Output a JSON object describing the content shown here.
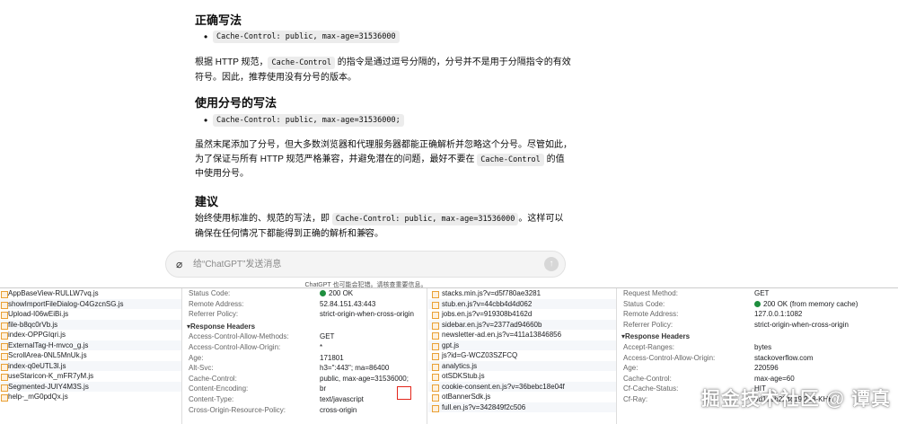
{
  "answer": {
    "heading_correct": "正确写法",
    "bullet_correct": "Cache-Control: public, max-age=31536000",
    "para1_prefix": "根据 HTTP 规范，",
    "para1_code": "Cache-Control",
    "para1_suffix": " 的指令是通过逗号分隔的，分号并不是用于分隔指令的有效符号。因此，推荐使用没有分号的版本。",
    "heading_semicolon": "使用分号的写法",
    "bullet_semicolon": "Cache-Control: public, max-age=31536000;",
    "para2_prefix": "虽然末尾添加了分号，但大多数浏览器和代理服务器都能正确解析并忽略这个分号。尽管如此，为了保证与所有 HTTP 规范严格兼容，并避免潜在的问题，最好不要在 ",
    "para2_code": "Cache-Control",
    "para2_suffix": " 的值中使用分号。",
    "heading_advice": "建议",
    "para3_prefix": "始终使用标准的、规范的写法，即 ",
    "para3_code": "Cache-Control: public, max-age=31536000",
    "para3_suffix": "。这样可以确保在任何情况下都能得到正确的解析和兼容。"
  },
  "composer": {
    "placeholder": "给“ChatGPT”发送消息",
    "disclaimer": "ChatGPT 也可能会犯错。请核查重要信息。"
  },
  "devtools": {
    "files_left": [
      "AppBaseView-RULLW7vq.js",
      "showImportFileDialog-O4GzcnSG.js",
      "Upload-I06wEiBi.js",
      "file-b8qc0rVb.js",
      "index-OPPGIqri.js",
      "ExternalTag-H-mvco_g.js",
      "ScrollArea-0NL5MnUk.js",
      "index-q0eUTL3l.js",
      "useStaricon-K_mFR7yM.js",
      "Segmented-JUIY4M3S.js",
      "help-_mG0pdQx.js"
    ],
    "headers_left_general": [
      {
        "k": "Status Code:",
        "v": "200 OK",
        "status": true
      },
      {
        "k": "Remote Address:",
        "v": "52.84.151.43:443"
      },
      {
        "k": "Referrer Policy:",
        "v": "strict-origin-when-cross-origin"
      }
    ],
    "response_headers_label": "▾Response Headers",
    "headers_left_response": [
      {
        "k": "Access-Control-Allow-Methods:",
        "v": "GET"
      },
      {
        "k": "Access-Control-Allow-Origin:",
        "v": "*"
      },
      {
        "k": "Age:",
        "v": "171801"
      },
      {
        "k": "Alt-Svc:",
        "v": "h3=\":443\"; ma=86400"
      },
      {
        "k": "Cache-Control:",
        "v": "public, max-age=31536000;"
      },
      {
        "k": "Content-Encoding:",
        "v": "br"
      },
      {
        "k": "Content-Type:",
        "v": "text/javascript"
      },
      {
        "k": "Cross-Origin-Resource-Policy:",
        "v": "cross-origin"
      }
    ],
    "files_right": [
      "stacks.min.js?v=d5f780ae3281",
      "stub.en.js?v=44cbb4d4d062",
      "jobs.en.js?v=919308b4162d",
      "sidebar.en.js?v=2377ad94660b",
      "newsletter-ad.en.js?v=411a13846856",
      "gpt.js",
      "js?id=G-WCZ03SZFCQ",
      "analytics.js",
      "otSDKStub.js",
      "cookie-consent.en.js?v=36bebc18e04f",
      "otBannerSdk.js",
      "full.en.js?v=342849f2c506"
    ],
    "headers_right_general": [
      {
        "k": "Request Method:",
        "v": "GET"
      },
      {
        "k": "Status Code:",
        "v": "200 OK (from memory cache)",
        "status": true
      },
      {
        "k": "Remote Address:",
        "v": "127.0.0.1:1082"
      },
      {
        "k": "Referrer Policy:",
        "v": "strict-origin-when-cross-origin"
      }
    ],
    "headers_right_response": [
      {
        "k": "Accept-Ranges:",
        "v": "bytes"
      },
      {
        "k": "Access-Control-Allow-Origin:",
        "v": "stackoverflow.com"
      },
      {
        "k": "Age:",
        "v": "220596"
      },
      {
        "k": "Cache-Control:",
        "v": "max-age=60"
      },
      {
        "k": "Cf-Cache-Status:",
        "v": "HIT"
      },
      {
        "k": "Cf-Ray:",
        "v": "8d1eeb224c19f228-KHH"
      }
    ]
  },
  "watermark": "掘金技术社区 @ 谭真",
  "colors": {
    "status_ok": "#1e8e3e",
    "highlight_box": "#e3261b",
    "selected_row": "#cfe3fb"
  }
}
